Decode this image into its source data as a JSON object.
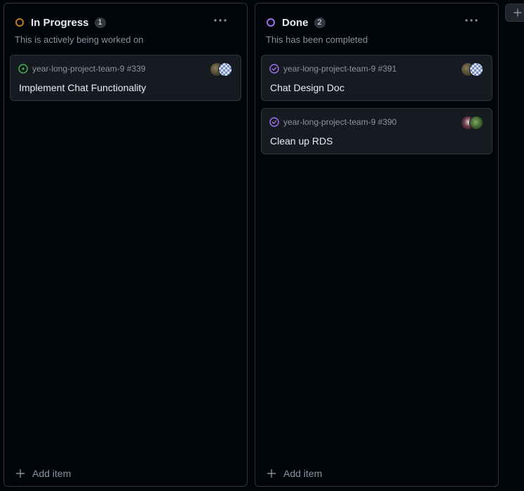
{
  "columns": [
    {
      "title": "In Progress",
      "count": "1",
      "description": "This is actively being worked on",
      "status_color": "#bb8009",
      "add_item_label": "Add item",
      "cards": [
        {
          "repo_ref": "year-long-project-team-9 #339",
          "title": "Implement Chat Functionality",
          "state_icon": "open-issue-icon",
          "state_color": "#3fb950"
        }
      ]
    },
    {
      "title": "Done",
      "count": "2",
      "description": "This has been completed",
      "status_color": "#a371f7",
      "add_item_label": "Add item",
      "cards": [
        {
          "repo_ref": "year-long-project-team-9 #391",
          "title": "Chat Design Doc",
          "state_icon": "closed-issue-icon",
          "state_color": "#a371f7"
        },
        {
          "repo_ref": "year-long-project-team-9 #390",
          "title": "Clean up RDS",
          "state_icon": "closed-issue-icon",
          "state_color": "#a371f7"
        }
      ]
    }
  ],
  "add_column_icon": "plus-icon"
}
